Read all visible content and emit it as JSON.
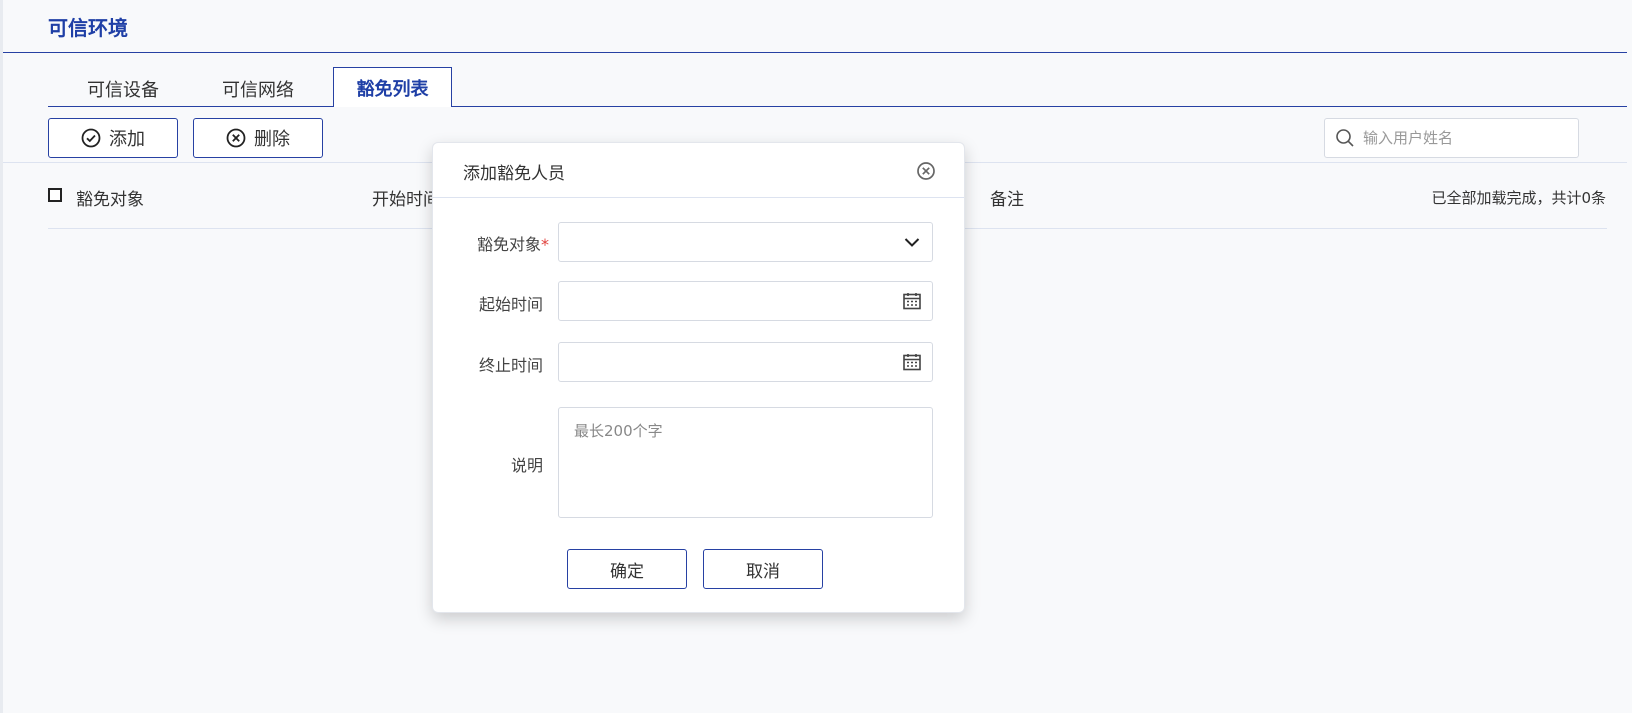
{
  "header": {
    "title": "可信环境"
  },
  "tabs": [
    {
      "label": "可信设备"
    },
    {
      "label": "可信网络"
    },
    {
      "label": "豁免列表"
    }
  ],
  "toolbar": {
    "add_label": "添加",
    "delete_label": "删除"
  },
  "search": {
    "placeholder": "输入用户姓名",
    "value": ""
  },
  "table": {
    "columns": [
      "豁免对象",
      "开始时间",
      "备注"
    ],
    "status": "已全部加载完成，共计0条"
  },
  "modal": {
    "title": "添加豁免人员",
    "fields": {
      "target_label": "豁免对象",
      "required_mark": "*",
      "start_label": "起始时间",
      "end_label": "终止时间",
      "desc_label": "说明",
      "desc_placeholder": "最长200个字"
    },
    "confirm_label": "确定",
    "cancel_label": "取消"
  },
  "colors": {
    "accent": "#2741a3",
    "required": "#e0403b",
    "background": "#f8f9fb"
  }
}
